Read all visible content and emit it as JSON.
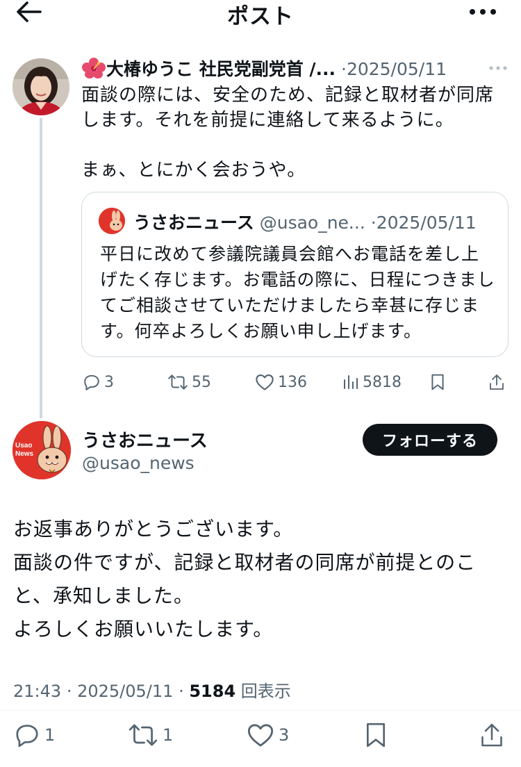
{
  "header": {
    "title": "ポスト"
  },
  "tweet1": {
    "author_name": "大椿ゆうこ 社民党副党首 /...",
    "separator": "·",
    "date": "2025/05/11",
    "text": "面談の際には、安全のため、記録と取材者が同席します。それを前提に連絡して来るように。\n\nまぁ、とにかく会おうや。",
    "quote": {
      "name": "うさおニュース",
      "handle": "@usao_ne...",
      "separator": "·",
      "date": "2025/05/11",
      "text": "平日に改めて参議院議員会館へお電話を差し上げたく存じます。お電話の際に、日程につきましてご相談させていただけましたら幸甚に存じます。何卒よろしくお願い申し上げます。"
    },
    "actions": {
      "replies": "3",
      "retweets": "55",
      "likes": "136",
      "views": "5818"
    }
  },
  "tweet2": {
    "name": "うさおニュース",
    "handle": "@usao_news",
    "follow_label": "フォローする",
    "text": "お返事ありがとうございます。\n面談の件ですが、記録と取材者の同席が前提とのこと、承知しました。\nよろしくお願いいたします。",
    "time": "21:43",
    "separator": "·",
    "date": "2025/05/11",
    "views_count": "5184",
    "views_label": "回表示",
    "actions": {
      "replies": "1",
      "retweets": "1",
      "likes": "3"
    }
  },
  "colors": {
    "text": "#0f1419",
    "secondary": "#536471",
    "border": "#cfd9de",
    "usao_red": "#e0342b"
  },
  "icons": [
    "back-arrow-icon",
    "more-icon",
    "hibiscus-icon",
    "reply-icon",
    "retweet-icon",
    "like-icon",
    "views-icon",
    "bookmark-icon",
    "share-icon"
  ]
}
